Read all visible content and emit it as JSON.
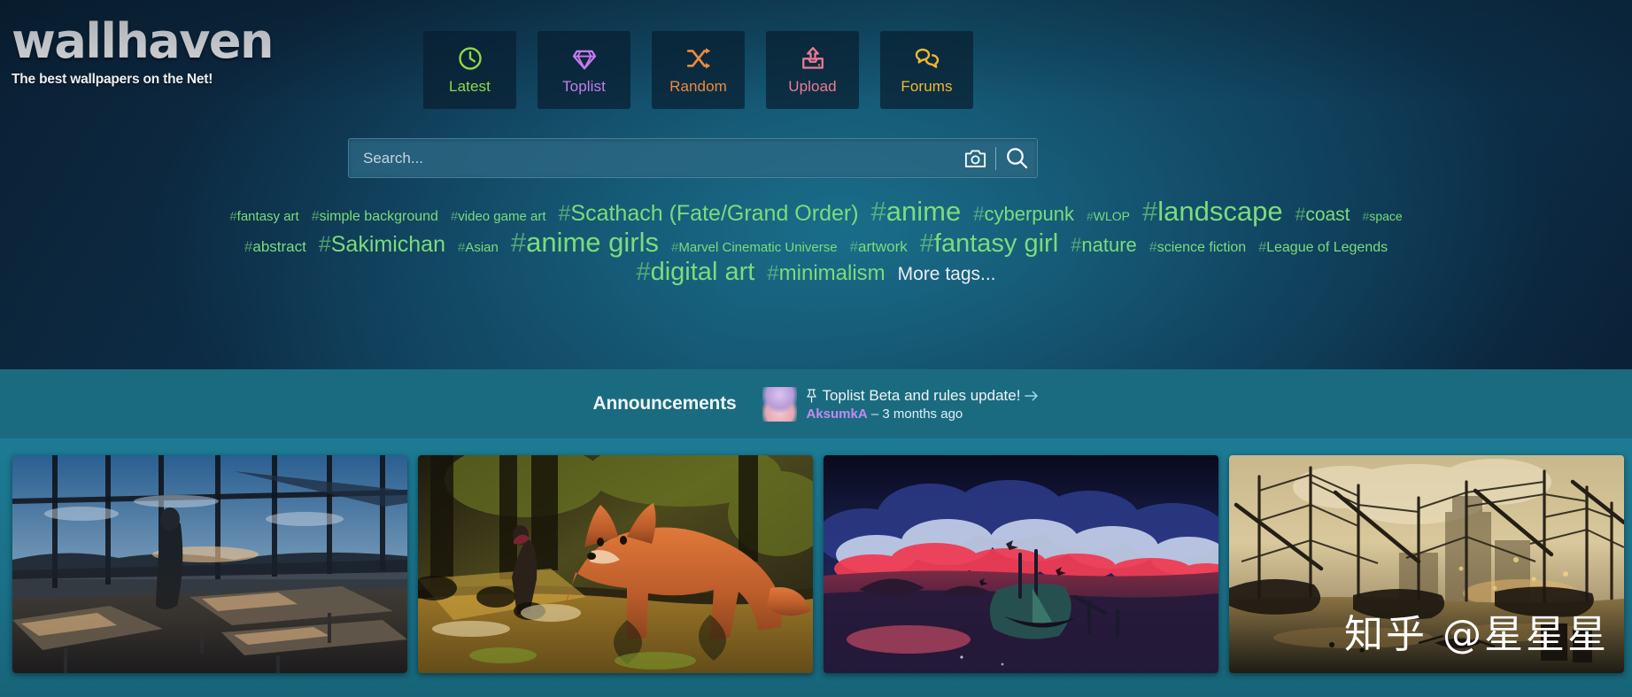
{
  "site": {
    "logo_text": "wallhaven",
    "tagline": "The best wallpapers on the Net!"
  },
  "nav": {
    "items": [
      {
        "label": "Latest",
        "icon": "clock-icon",
        "color": "#8fd94a"
      },
      {
        "label": "Toplist",
        "icon": "gem-icon",
        "color": "#c77bf0"
      },
      {
        "label": "Random",
        "icon": "shuffle-icon",
        "color": "#f08a3c"
      },
      {
        "label": "Upload",
        "icon": "upload-icon",
        "color": "#ef7a93"
      },
      {
        "label": "Forums",
        "icon": "comments-icon",
        "color": "#f0b92c"
      }
    ]
  },
  "search": {
    "placeholder": "Search...",
    "value": "",
    "camera_icon": "camera-icon",
    "submit_icon": "search-icon"
  },
  "tags": {
    "rows": [
      [
        {
          "name": "fantasy art",
          "size": 15
        },
        {
          "name": "simple background",
          "size": 16
        },
        {
          "name": "video game art",
          "size": 15
        },
        {
          "name": "Scathach (Fate/Grand Order)",
          "size": 25
        },
        {
          "name": "anime",
          "size": 31
        },
        {
          "name": "cyberpunk",
          "size": 22
        },
        {
          "name": "WLOP",
          "size": 14
        },
        {
          "name": "landscape",
          "size": 31
        },
        {
          "name": "coast",
          "size": 21
        },
        {
          "name": "space",
          "size": 14
        }
      ],
      [
        {
          "name": "abstract",
          "size": 17
        },
        {
          "name": "Sakimichan",
          "size": 25
        },
        {
          "name": "Asian",
          "size": 15
        },
        {
          "name": "anime girls",
          "size": 31
        },
        {
          "name": "Marvel Cinematic Universe",
          "size": 15
        },
        {
          "name": "artwork",
          "size": 17
        },
        {
          "name": "fantasy girl",
          "size": 29
        },
        {
          "name": "nature",
          "size": 22
        },
        {
          "name": "science fiction",
          "size": 16
        },
        {
          "name": "League of Legends",
          "size": 16
        }
      ],
      [
        {
          "name": "digital art",
          "size": 29
        },
        {
          "name": "minimalism",
          "size": 24
        }
      ]
    ],
    "more_label": "More tags..."
  },
  "announcements": {
    "title": "Announcements",
    "headline": "Toplist Beta and rules update!",
    "pin_icon": "pin-icon",
    "arrow_icon": "arrow-right-icon",
    "author": "AksumkA",
    "separator": "–",
    "timestamp": "3 months ago"
  },
  "thumbnails": [
    {
      "alt": "anime classroom sunset window"
    },
    {
      "alt": "giant fox in forest stream"
    },
    {
      "alt": "red clouds over shipwreck at dusk"
    },
    {
      "alt": "tall ships in sepia harbor"
    }
  ],
  "watermark": {
    "text": "知乎 @星星星"
  },
  "colors": {
    "tag_green": "#7bdc7b",
    "announce_bar": "#1b6b80",
    "thumb_strip": "#1a7088"
  }
}
